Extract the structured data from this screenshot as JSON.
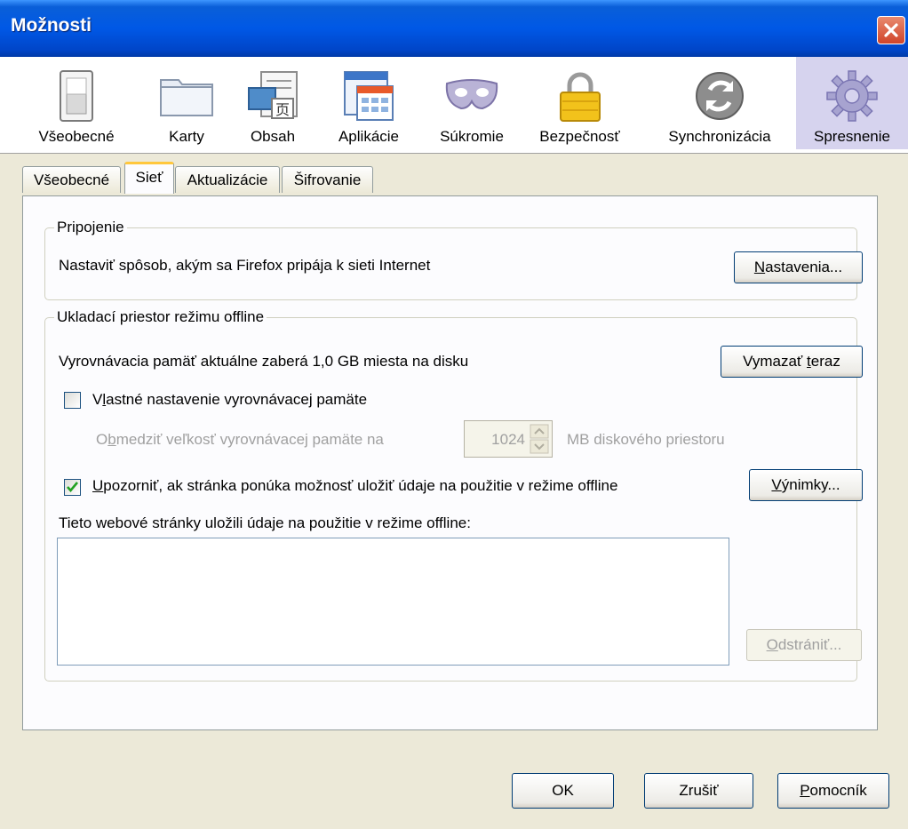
{
  "window": {
    "title": "Možnosti"
  },
  "toolbar": {
    "items": [
      {
        "label": "Všeobecné",
        "icon": "switch-icon"
      },
      {
        "label": "Karty",
        "icon": "folder-icon"
      },
      {
        "label": "Obsah",
        "icon": "content-icon"
      },
      {
        "label": "Aplikácie",
        "icon": "applications-icon"
      },
      {
        "label": "Súkromie",
        "icon": "mask-icon"
      },
      {
        "label": "Bezpečnosť",
        "icon": "padlock-icon"
      },
      {
        "label": "Synchronizácia",
        "icon": "sync-icon"
      },
      {
        "label": "Spresnenie",
        "icon": "gear-icon"
      }
    ],
    "active": "Spresnenie"
  },
  "tabs": {
    "items": [
      "Všeobecné",
      "Sieť",
      "Aktualizácie",
      "Šifrovanie"
    ],
    "active": "Sieť"
  },
  "connection": {
    "legend": "Pripojenie",
    "description": "Nastaviť spôsob, akým sa Firefox pripája k sieti Internet",
    "settings_button": "Nastavenia..."
  },
  "offline": {
    "legend": "Ukladací priestor režimu offline",
    "cache_usage": "Vyrovnávacia pamäť aktuálne zaberá 1,0 GB miesta na disku",
    "clear_button": "Vymazať teraz",
    "override_cache_label": "Vlastné nastavenie vyrovnávacej pamäte",
    "override_cache_checked": false,
    "limit_label": "Obmedziť veľkosť vyrovnávacej pamäte na",
    "limit_value": "1024",
    "limit_unit": "MB diskového priestoru",
    "warn_label": "Upozorniť, ak stránka ponúka možnosť uložiť údaje na použitie v režime offline",
    "warn_checked": true,
    "exceptions_button": "Výnimky...",
    "sites_label": "Tieto webové stránky uložili údaje na použitie v režime offline:",
    "sites": [],
    "remove_button": "Odstrániť..."
  },
  "footer": {
    "ok": "OK",
    "cancel": "Zrušiť",
    "help": "Pomocník"
  }
}
